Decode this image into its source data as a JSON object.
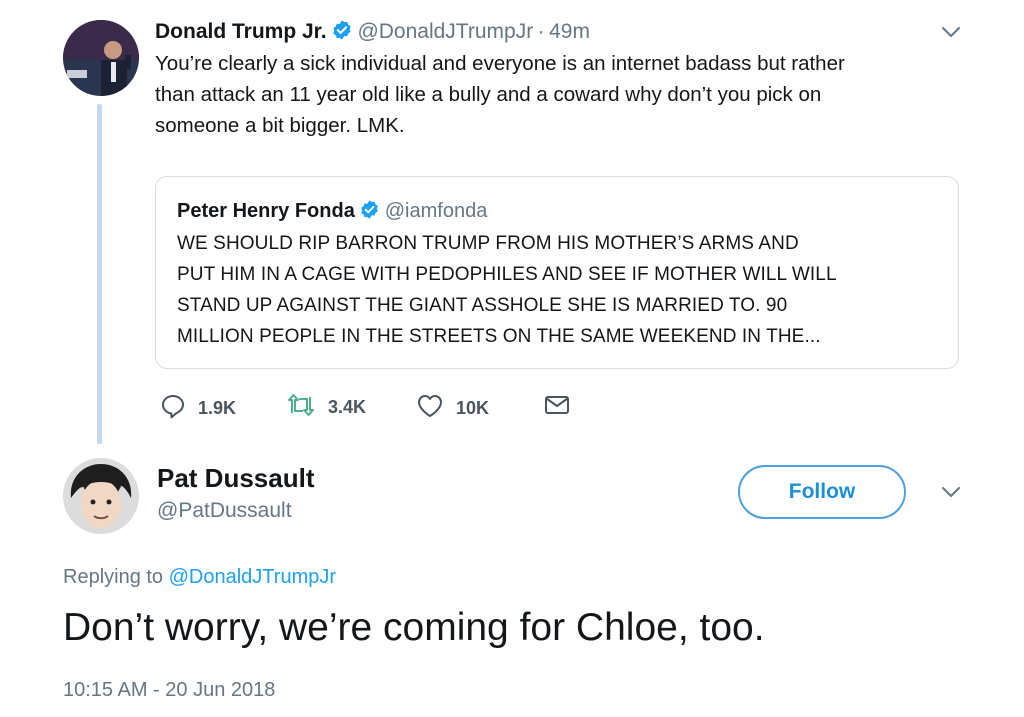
{
  "quoted_tweet": {
    "author_name": "Donald Trump Jr.",
    "author_handle": "@DonaldJTrumpJr",
    "separator": "·",
    "time": "49m",
    "text": "You’re clearly a sick individual and everyone is an internet badass but rather than attack an 11 year old like a bully and a coward why don’t you pick on someone a bit bigger. LMK.",
    "lines": [
      "You’re clearly a sick individual and everyone is an internet badass but rather",
      "than attack an 11 year old like a bully and a coward why don’t you pick on",
      "someone a bit bigger. LMK."
    ],
    "embedded": {
      "author_name": "Peter Henry Fonda",
      "author_handle": "@iamfonda",
      "lines": [
        "WE SHOULD RIP BARRON TRUMP FROM HIS MOTHER’S ARMS AND",
        "PUT HIM IN A CAGE WITH PEDOPHILES AND SEE IF MOTHER WILL WILL",
        "STAND UP AGAINST THE GIANT ASSHOLE SHE IS MARRIED TO. 90",
        "MILLION PEOPLE IN THE STREETS ON THE SAME WEEKEND IN THE..."
      ]
    },
    "stats": {
      "replies": "1.9K",
      "retweets": "3.4K",
      "likes": "10K"
    }
  },
  "main_tweet": {
    "author_name": "Pat Dussault",
    "author_handle": "@PatDussault",
    "follow_label": "Follow",
    "replying_prefix": "Replying to",
    "replying_handle": "@DonaldJTrumpJr",
    "text": "Don’t worry, we’re coming for Chloe, too.",
    "timestamp": "10:15 AM - 20 Jun 2018"
  },
  "colors": {
    "accent": "#1da1f2",
    "text": "#14171a",
    "muted": "#657786",
    "thread_line": "#c4d9ea"
  },
  "icons": [
    "verified-badge-icon",
    "chevron-down-icon",
    "reply-icon",
    "retweet-icon",
    "like-icon",
    "dm-icon"
  ]
}
